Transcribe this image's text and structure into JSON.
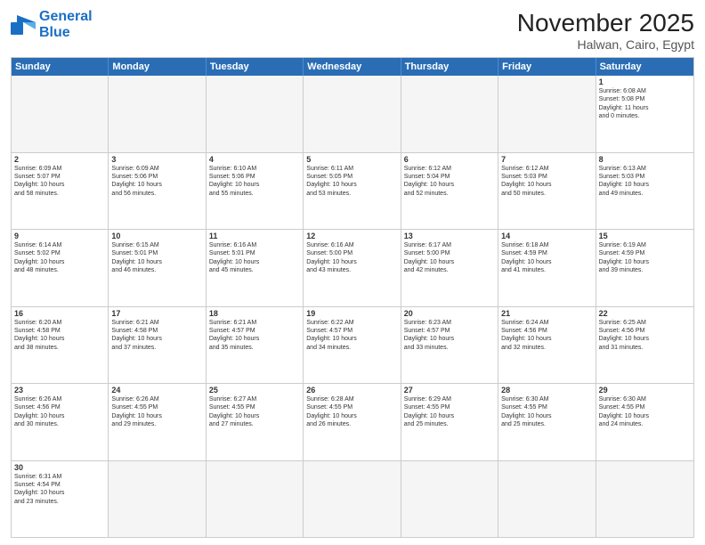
{
  "header": {
    "logo_general": "General",
    "logo_blue": "Blue",
    "month_title": "November 2025",
    "location": "Halwan, Cairo, Egypt"
  },
  "day_headers": [
    "Sunday",
    "Monday",
    "Tuesday",
    "Wednesday",
    "Thursday",
    "Friday",
    "Saturday"
  ],
  "weeks": [
    [
      {
        "num": "",
        "info": ""
      },
      {
        "num": "",
        "info": ""
      },
      {
        "num": "",
        "info": ""
      },
      {
        "num": "",
        "info": ""
      },
      {
        "num": "",
        "info": ""
      },
      {
        "num": "",
        "info": ""
      },
      {
        "num": "1",
        "info": "Sunrise: 6:08 AM\nSunset: 5:08 PM\nDaylight: 11 hours\nand 0 minutes."
      }
    ],
    [
      {
        "num": "2",
        "info": "Sunrise: 6:09 AM\nSunset: 5:07 PM\nDaylight: 10 hours\nand 58 minutes."
      },
      {
        "num": "3",
        "info": "Sunrise: 6:09 AM\nSunset: 5:06 PM\nDaylight: 10 hours\nand 56 minutes."
      },
      {
        "num": "4",
        "info": "Sunrise: 6:10 AM\nSunset: 5:06 PM\nDaylight: 10 hours\nand 55 minutes."
      },
      {
        "num": "5",
        "info": "Sunrise: 6:11 AM\nSunset: 5:05 PM\nDaylight: 10 hours\nand 53 minutes."
      },
      {
        "num": "6",
        "info": "Sunrise: 6:12 AM\nSunset: 5:04 PM\nDaylight: 10 hours\nand 52 minutes."
      },
      {
        "num": "7",
        "info": "Sunrise: 6:12 AM\nSunset: 5:03 PM\nDaylight: 10 hours\nand 50 minutes."
      },
      {
        "num": "8",
        "info": "Sunrise: 6:13 AM\nSunset: 5:03 PM\nDaylight: 10 hours\nand 49 minutes."
      }
    ],
    [
      {
        "num": "9",
        "info": "Sunrise: 6:14 AM\nSunset: 5:02 PM\nDaylight: 10 hours\nand 48 minutes."
      },
      {
        "num": "10",
        "info": "Sunrise: 6:15 AM\nSunset: 5:01 PM\nDaylight: 10 hours\nand 46 minutes."
      },
      {
        "num": "11",
        "info": "Sunrise: 6:16 AM\nSunset: 5:01 PM\nDaylight: 10 hours\nand 45 minutes."
      },
      {
        "num": "12",
        "info": "Sunrise: 6:16 AM\nSunset: 5:00 PM\nDaylight: 10 hours\nand 43 minutes."
      },
      {
        "num": "13",
        "info": "Sunrise: 6:17 AM\nSunset: 5:00 PM\nDaylight: 10 hours\nand 42 minutes."
      },
      {
        "num": "14",
        "info": "Sunrise: 6:18 AM\nSunset: 4:59 PM\nDaylight: 10 hours\nand 41 minutes."
      },
      {
        "num": "15",
        "info": "Sunrise: 6:19 AM\nSunset: 4:59 PM\nDaylight: 10 hours\nand 39 minutes."
      }
    ],
    [
      {
        "num": "16",
        "info": "Sunrise: 6:20 AM\nSunset: 4:58 PM\nDaylight: 10 hours\nand 38 minutes."
      },
      {
        "num": "17",
        "info": "Sunrise: 6:21 AM\nSunset: 4:58 PM\nDaylight: 10 hours\nand 37 minutes."
      },
      {
        "num": "18",
        "info": "Sunrise: 6:21 AM\nSunset: 4:57 PM\nDaylight: 10 hours\nand 35 minutes."
      },
      {
        "num": "19",
        "info": "Sunrise: 6:22 AM\nSunset: 4:57 PM\nDaylight: 10 hours\nand 34 minutes."
      },
      {
        "num": "20",
        "info": "Sunrise: 6:23 AM\nSunset: 4:57 PM\nDaylight: 10 hours\nand 33 minutes."
      },
      {
        "num": "21",
        "info": "Sunrise: 6:24 AM\nSunset: 4:56 PM\nDaylight: 10 hours\nand 32 minutes."
      },
      {
        "num": "22",
        "info": "Sunrise: 6:25 AM\nSunset: 4:56 PM\nDaylight: 10 hours\nand 31 minutes."
      }
    ],
    [
      {
        "num": "23",
        "info": "Sunrise: 6:26 AM\nSunset: 4:56 PM\nDaylight: 10 hours\nand 30 minutes."
      },
      {
        "num": "24",
        "info": "Sunrise: 6:26 AM\nSunset: 4:55 PM\nDaylight: 10 hours\nand 29 minutes."
      },
      {
        "num": "25",
        "info": "Sunrise: 6:27 AM\nSunset: 4:55 PM\nDaylight: 10 hours\nand 27 minutes."
      },
      {
        "num": "26",
        "info": "Sunrise: 6:28 AM\nSunset: 4:55 PM\nDaylight: 10 hours\nand 26 minutes."
      },
      {
        "num": "27",
        "info": "Sunrise: 6:29 AM\nSunset: 4:55 PM\nDaylight: 10 hours\nand 25 minutes."
      },
      {
        "num": "28",
        "info": "Sunrise: 6:30 AM\nSunset: 4:55 PM\nDaylight: 10 hours\nand 25 minutes."
      },
      {
        "num": "29",
        "info": "Sunrise: 6:30 AM\nSunset: 4:55 PM\nDaylight: 10 hours\nand 24 minutes."
      }
    ],
    [
      {
        "num": "30",
        "info": "Sunrise: 6:31 AM\nSunset: 4:54 PM\nDaylight: 10 hours\nand 23 minutes."
      },
      {
        "num": "",
        "info": ""
      },
      {
        "num": "",
        "info": ""
      },
      {
        "num": "",
        "info": ""
      },
      {
        "num": "",
        "info": ""
      },
      {
        "num": "",
        "info": ""
      },
      {
        "num": "",
        "info": ""
      }
    ]
  ]
}
